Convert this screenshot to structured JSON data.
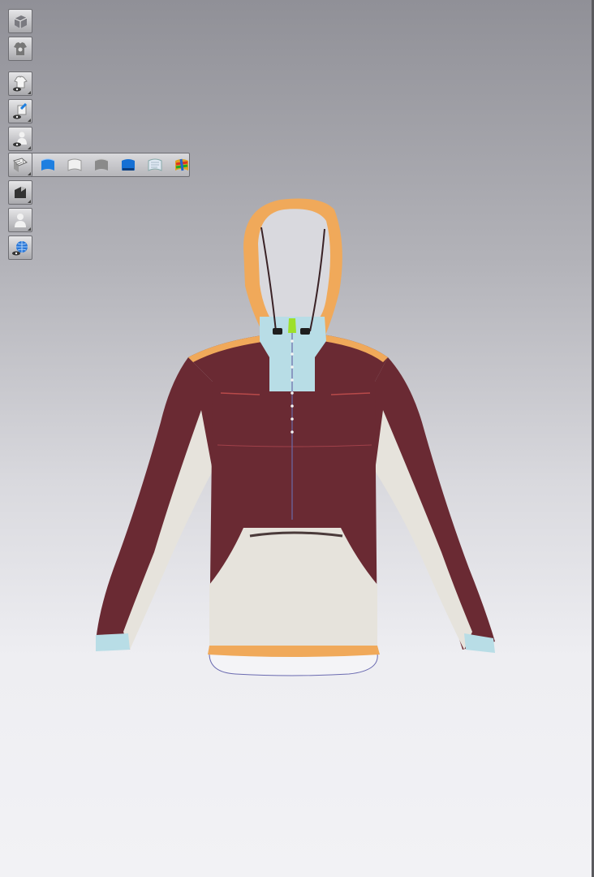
{
  "app": {
    "view": "3d-garment-viewport"
  },
  "toolbar": {
    "buttons": [
      {
        "name": "3d-box-icon"
      },
      {
        "name": "garment-settings-icon"
      },
      {
        "name": "show-garment-icon"
      },
      {
        "name": "show-avatar-texture-icon"
      },
      {
        "name": "show-avatar-icon"
      },
      {
        "name": "texture-mode-icon"
      },
      {
        "name": "render-mode-icon"
      },
      {
        "name": "avatar-silhouette-icon"
      },
      {
        "name": "environment-globe-icon"
      }
    ],
    "flyout": [
      {
        "name": "texture-blue-option-icon",
        "color": "#1e7fe0"
      },
      {
        "name": "texture-white-option-icon",
        "color": "#f0f0f0"
      },
      {
        "name": "texture-gray-option-icon",
        "color": "#8a8a8a"
      },
      {
        "name": "texture-blue-alt-option-icon",
        "color": "#1670d4"
      },
      {
        "name": "texture-light-option-icon",
        "color": "#dfe8f2"
      },
      {
        "name": "texture-rainbow-option-icon",
        "color": "#e0a020"
      }
    ]
  },
  "garment": {
    "type": "anorak-hoodie",
    "colors": {
      "body": "#6a2a33",
      "panel": "#e6e3dc",
      "hood": "#f0a95a",
      "collar": "#b8dde6",
      "zip_pull": "#9de02b"
    }
  }
}
